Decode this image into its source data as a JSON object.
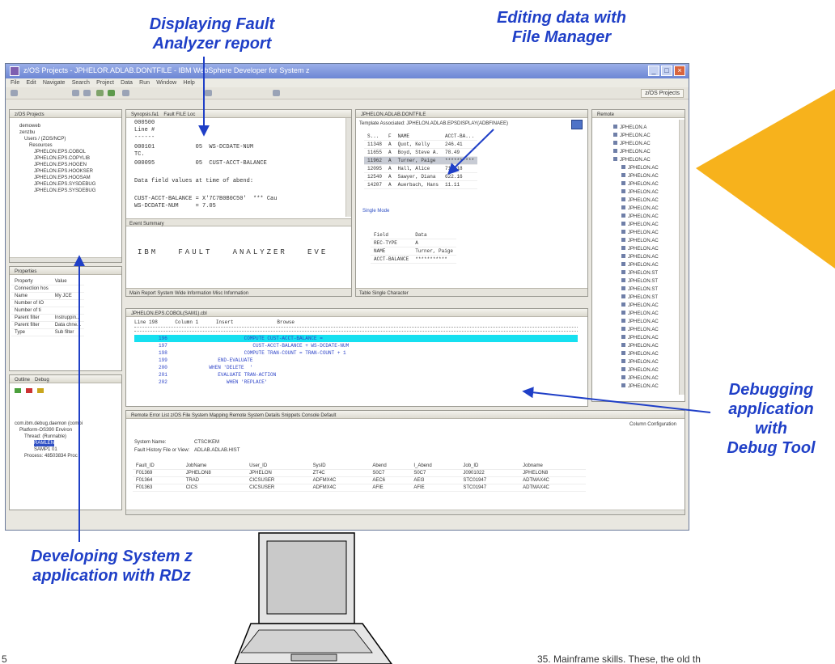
{
  "callouts": {
    "fault": "Displaying Fault\nAnalyzer report",
    "filemgr": "Editing data with\nFile Manager",
    "debug": "Debugging\napplication\nwith\nDebug Tool",
    "rdz": "Developing System z\napplication with RDz"
  },
  "window": {
    "title": "z/OS Projects - JPHELOR.ADLAB.DONTFILE - IBM WebSphere Developer for System z",
    "menu": [
      "File",
      "Edit",
      "Navigate",
      "Search",
      "Project",
      "Data",
      "Run",
      "Window",
      "Help"
    ],
    "perspective": "z/OS Projects"
  },
  "projects": {
    "tab": "z/OS Projects",
    "items": [
      "demoweb",
      "zenzbu",
      "Users / (ZOS/NCP)",
      "Resources",
      "JPHELON.EPS.COBOL",
      "JPHELON.EPS.COPYLIB",
      "JPHELON.EPS.HOGEN",
      "JPHELON.EPS.HOOKSER",
      "JPHELON.EPS.HOOSAM",
      "JPHELON.EPS.SYSDEBUG",
      "JPHELON.EPS.SYSDEBUG"
    ]
  },
  "properties": {
    "tab": "Properties",
    "headers": [
      "Property",
      "Value"
    ],
    "rows": [
      [
        "Connection hos",
        ""
      ],
      [
        "Name",
        "My JCE"
      ],
      [
        "Number of IO",
        ""
      ],
      [
        "Number of ti",
        ""
      ],
      [
        "Parent filter",
        "Instruppin..."
      ],
      [
        "Parent filter",
        "Data chne..."
      ],
      [
        "Type",
        "Sub filter"
      ]
    ]
  },
  "debugview": {
    "tabs": [
      "Outline",
      "Debug"
    ],
    "items": [
      "com.ibm.debug.daemon (compi",
      "Platform-OS390 Environ",
      "Thread: (Runnable)",
      "RAMLEN",
      "SAMP1 01",
      "Process: 48503834 Proc"
    ]
  },
  "fault": {
    "tabs": [
      "Synopsis.fa1",
      "Fault FILE Loc"
    ],
    "lines": [
      "000500",
      "Line #",
      "------",
      "000101            05  WS-DCDATE-NUM",
      "TC.",
      "000095            05  CUST-ACCT-BALANCE",
      "",
      "Data field values at time of abend:",
      "",
      "CUST-ACCT-BALANCE = X'7C7B0B0C50'  *** Cau",
      "WS-DCDATE-NUM     = 7.05"
    ],
    "summary_tab": "Event Summary",
    "banner": "IBM   FAULT   ANALYZER   EVE",
    "bottom_tabs": "Main Report  System Wide Information  Misc Information"
  },
  "filemgr": {
    "tab": "JPHELON.ADLAB.DONTFILE",
    "template": "Template Associated: JPHELON.ADLAB.EPSDISPLAY(ADBFINAEE)",
    "header": [
      "S...",
      "F",
      "NAME",
      "ACCT-BA..."
    ],
    "rows": [
      [
        "11348",
        "A",
        "Quot, Kelly",
        "246.41"
      ],
      [
        "11655",
        "A",
        "Boyd, Steve A.",
        "78.49"
      ],
      [
        "11962",
        "A",
        "Turner, Paige",
        "**********"
      ],
      [
        "12095",
        "A",
        "Hall, Alice",
        "710.18"
      ],
      [
        "12540",
        "A",
        "Sawyer, Diana",
        "622.16"
      ],
      [
        "14207",
        "A",
        "Auerbach, Hans",
        "11.11"
      ]
    ],
    "single_label": "Single Mode",
    "field_headers": [
      "Field",
      "Data"
    ],
    "fields": [
      [
        "REC-TYPE",
        "A"
      ],
      [
        "NAME",
        "Turner, Paige"
      ],
      [
        "ACCT-BALANCE",
        "***********"
      ]
    ],
    "bottom_tabs": "Table  Single  Character"
  },
  "source": {
    "tab": "JPHELON.EPS.COBOL(SAM1).cbl",
    "ruler_head": "Line 198      Column 1      Insert               Browse",
    "rows": [
      {
        "ln": "196",
        "code": "                     COMPUTE CUST-ACCT-BALANCE =",
        "hl": true
      },
      {
        "ln": "197",
        "code": "                        CUST-ACCT-BALANCE + WS-DCDATE-NUM",
        "hl": false
      },
      {
        "ln": "198",
        "code": "                     COMPUTE TRAN-COUNT = TRAN-COUNT + 1",
        "hl": false
      },
      {
        "ln": "199",
        "code": "            END-EVALUATE",
        "hl": false
      },
      {
        "ln": "200",
        "code": "         WHEN 'DELETE  '",
        "hl": false
      },
      {
        "ln": "201",
        "code": "            EVALUATE TRAN-ACTION",
        "hl": false
      },
      {
        "ln": "202",
        "code": "               WHEN 'REPLACE'",
        "hl": false
      }
    ]
  },
  "remote": {
    "tab": "Remote",
    "items": [
      "JPHELON.A",
      "JPHELON.AC",
      "JPHELON.AC",
      "JPHELON.AC",
      "JPHELON.AC",
      "JPHELON.AC",
      "JPHELON.AC",
      "JPHELON.AC",
      "JPHELON.AC",
      "JPHELON.AC",
      "JPHELON.AC",
      "JPHELON.AC",
      "JPHELON.AC",
      "JPHELON.AC",
      "JPHELON.AC",
      "JPHELON.AC",
      "JPHELON.AC",
      "JPHELON.AC",
      "JPHELON.ST",
      "JPHELON.ST",
      "JPHELON.ST",
      "JPHELON.ST",
      "JPHELON.AC",
      "JPHELON.AC",
      "JPHELON.AC",
      "JPHELON.AC",
      "JPHELON.AC",
      "JPHELON.AC",
      "JPHELON.AC",
      "JPHELON.AC",
      "JPHELON.AC",
      "JPHELON.AC",
      "JPHELON.AC"
    ]
  },
  "faultview": {
    "tabs": "Remote Error List  z/OS File System Mapping  Remote System Details  Snippets  Console  Default",
    "config": "Column Configuration",
    "system_label": "System Name:",
    "system_value": "CTSCIKEM",
    "history_label": "Fault History File or View:",
    "history_value": "ADLAB.ADLAB.HIST",
    "headers": [
      "Fault_ID",
      "JobName",
      "User_ID",
      "SysID",
      "Abend",
      "I_Abend",
      "Job_ID",
      "Jobname"
    ],
    "rows": [
      [
        "F01369",
        "JPHELON8",
        "JPHELON",
        "ZT4C",
        "S0C7",
        "S0C7",
        "J0901022",
        "JPHELON8"
      ],
      [
        "F01364",
        "TRAD",
        "CICSUSER",
        "ADFMX4C",
        "AEC6",
        "AEI3",
        "STC01947",
        "ADTMAX4C"
      ],
      [
        "F01363",
        "CICS",
        "CICSUSER",
        "ADFMX4C",
        "AFIE",
        "AFIE",
        "STC01947",
        "ADTMAX4C"
      ]
    ]
  },
  "footer": {
    "left_num": "5",
    "right_text": "35. Mainframe skills. These, the old th"
  },
  "colors": {
    "callout": "#1f3fc7",
    "arrow": "#1f3fc7",
    "orange": "#f7b21c",
    "highlight": "#16e0f0"
  }
}
